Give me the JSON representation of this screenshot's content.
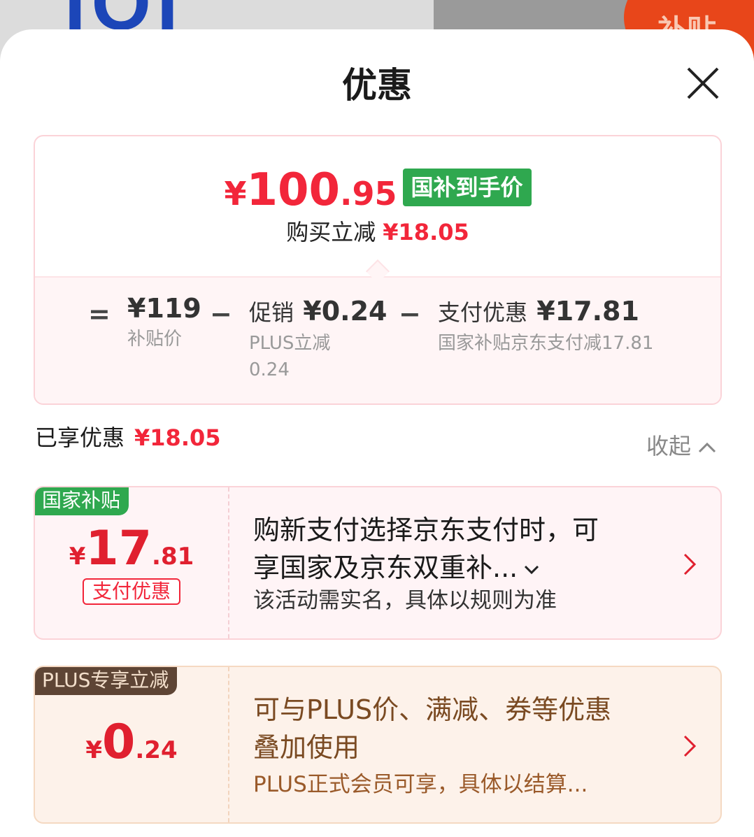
{
  "header": {
    "title": "优惠"
  },
  "summary": {
    "price_currency": "¥",
    "price_integer": "100",
    "price_decimal": ".95",
    "price_tag": "国补到手价",
    "save_label": "购买立减",
    "save_value": "¥18.05",
    "breakdown": {
      "eq": "=",
      "base_value": "¥119",
      "base_label": "补贴价",
      "minus1": "−",
      "promo_label": "促销",
      "promo_value": "¥0.24",
      "promo_sub_1": "PLUS立减",
      "promo_sub_2": "0.24",
      "minus2": "−",
      "pay_label": "支付优惠",
      "pay_value": "¥17.81",
      "pay_sub": "国家补贴京东支付减17.81"
    }
  },
  "enjoyed": {
    "label": "已享优惠",
    "value": "¥18.05",
    "collapse_label": "收起"
  },
  "coupons": [
    {
      "badge": "国家补贴",
      "currency": "¥",
      "integer": "17",
      "decimal": ".81",
      "tag": "支付优惠",
      "desc_line1": "购新支付选择京东支付时，可",
      "desc_line2": "享国家及京东双重补...",
      "note": "该活动需实名，具体以规则为准"
    },
    {
      "badge": "PLUS专享立减",
      "currency": "¥",
      "integer": "0",
      "decimal": ".24",
      "desc_line1": "可与PLUS价、满减、券等优惠",
      "desc_line2": "叠加使用",
      "note": "PLUS正式会员可享，具体以结算..."
    }
  ],
  "colors": {
    "accent_red": "#f2263a",
    "green_tag": "#2fa84f",
    "plus_badge": "#5e4535"
  }
}
